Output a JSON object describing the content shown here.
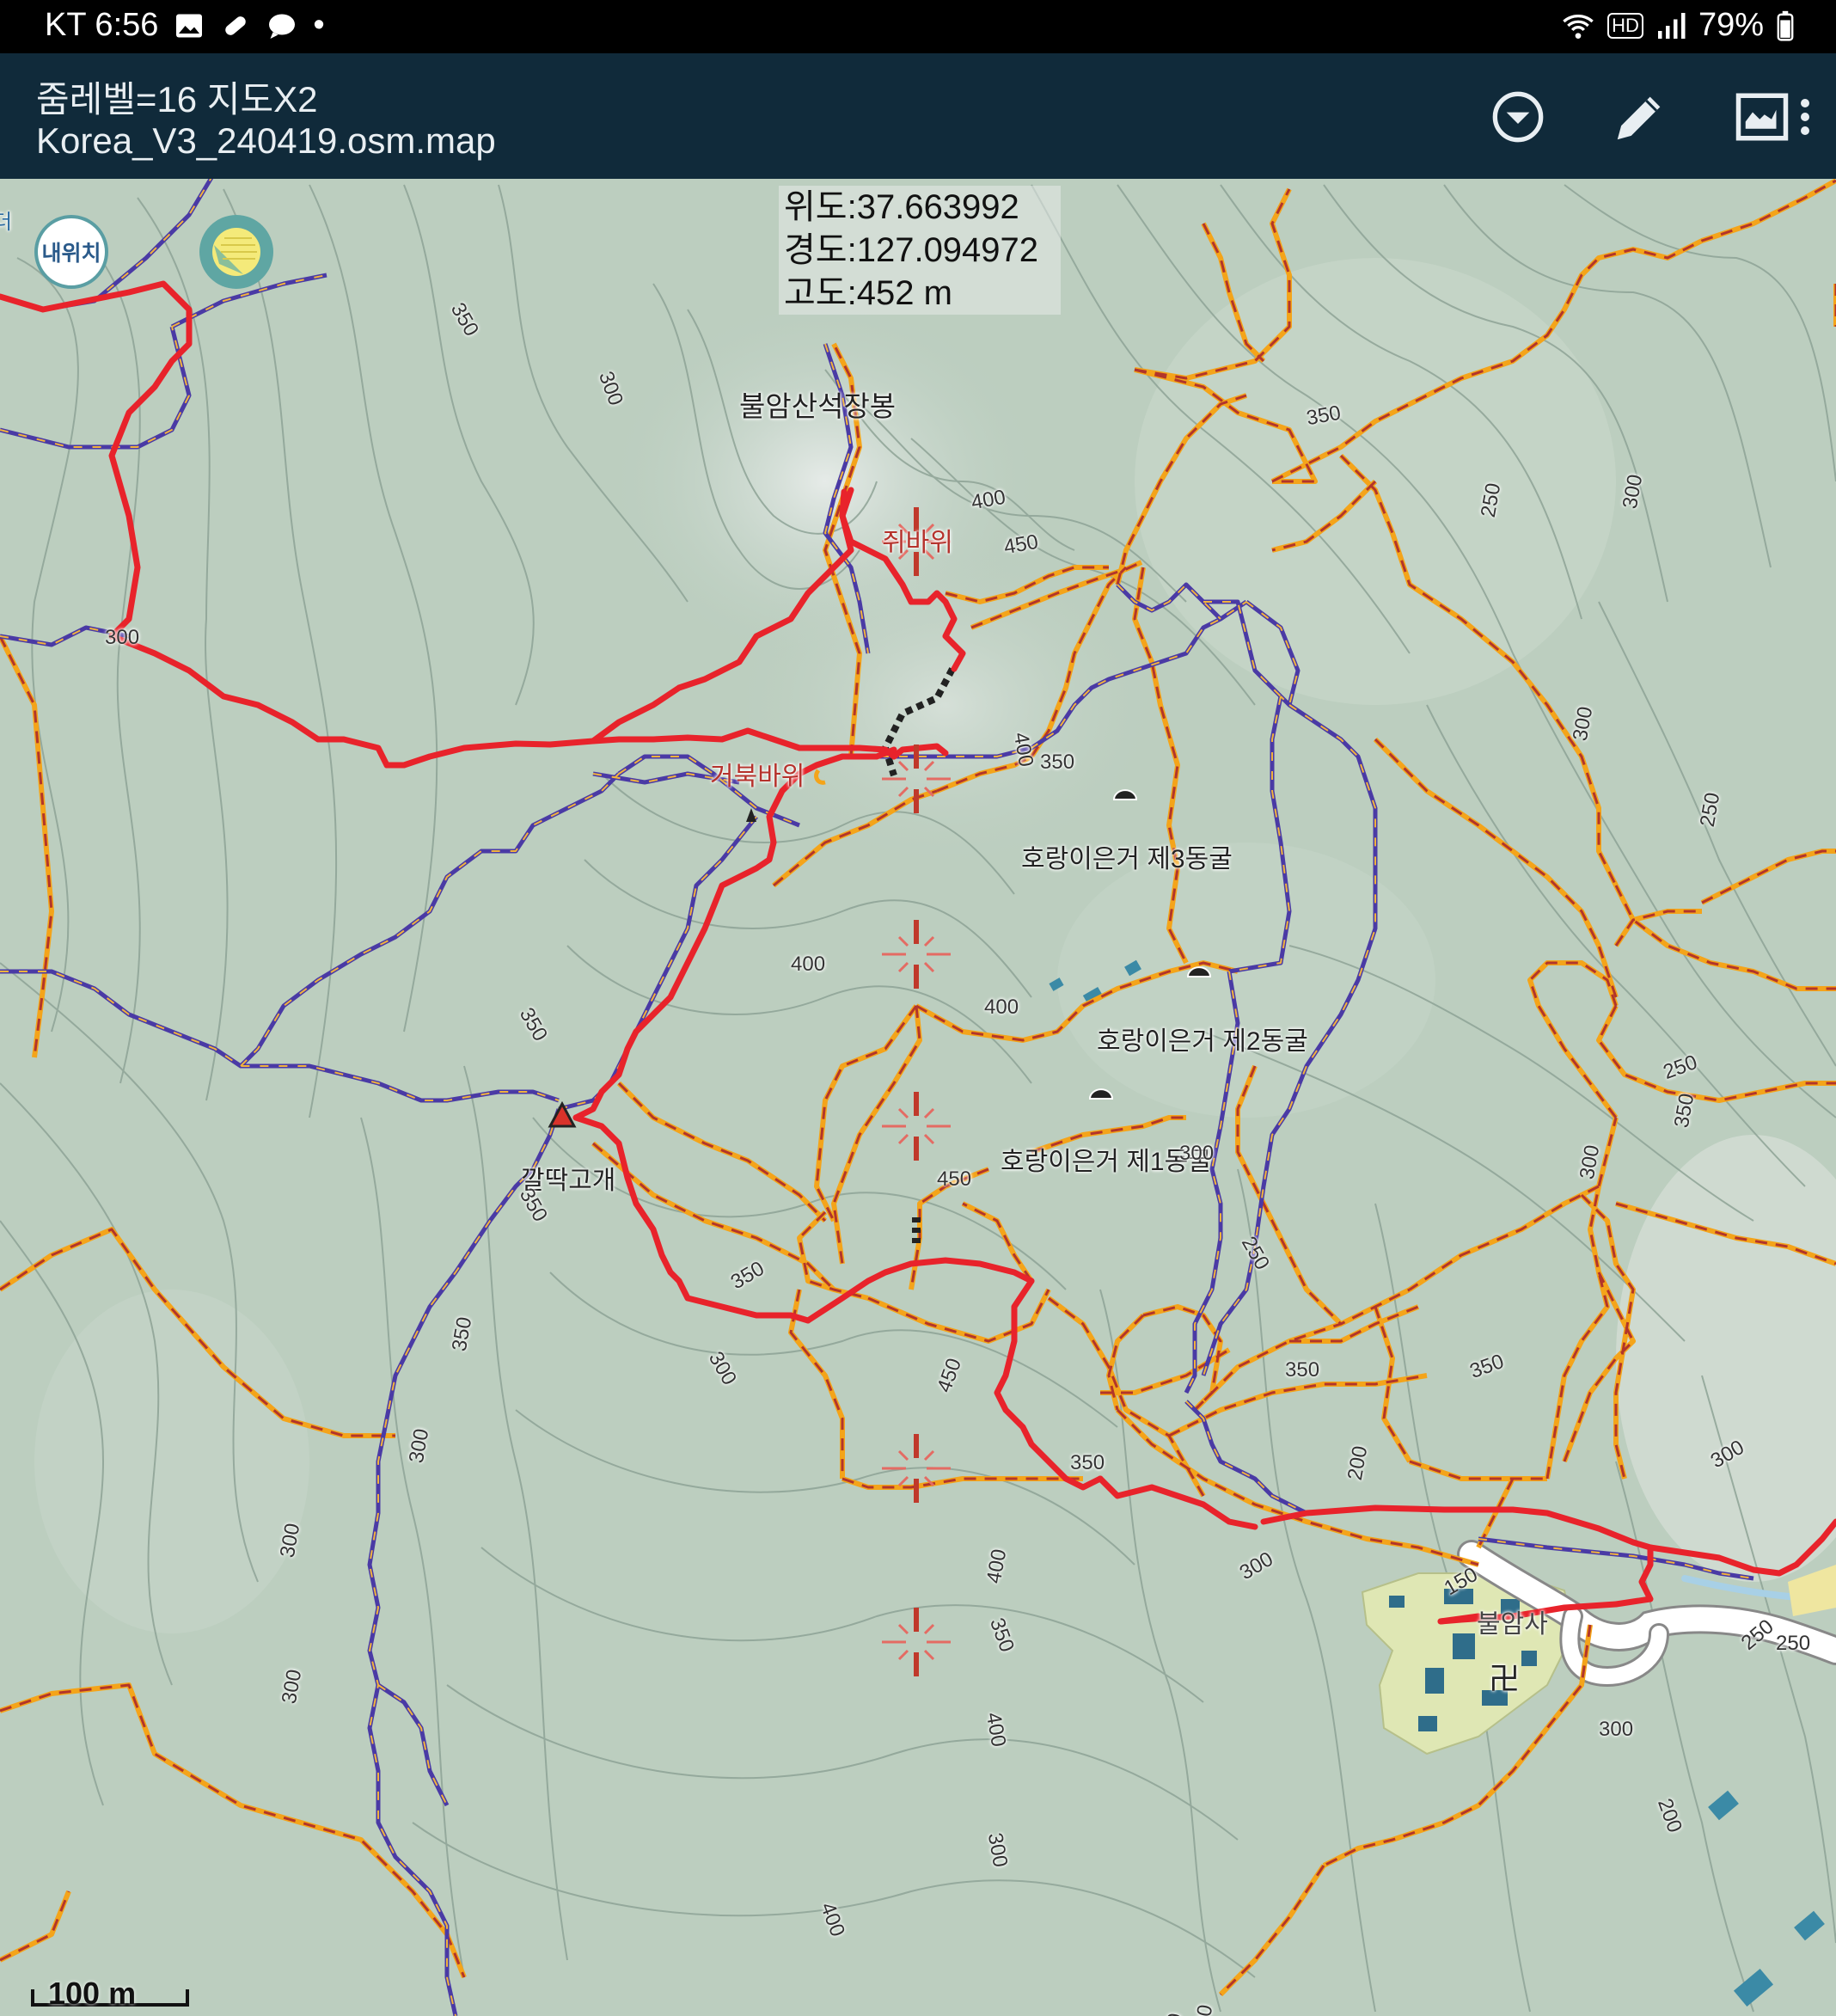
{
  "status_bar": {
    "carrier_time": "KT 6:56",
    "battery": "79%",
    "hd": "HD",
    "icons": [
      "gallery-icon",
      "pill-icon",
      "chat-icon",
      "dot-icon",
      "wifi-icon",
      "signal-icon",
      "battery-icon"
    ]
  },
  "app_bar": {
    "title": "줌레벨=16 지도X2",
    "subtitle": "Korea_V3_240419.osm.map",
    "actions": [
      "dropdown-icon",
      "pencil-icon",
      "map-layer-icon",
      "more-vert-icon"
    ]
  },
  "coords": {
    "lat": "위도:37.663992",
    "lon": "경도:127.094972",
    "alt": "고도:452 m"
  },
  "buttons": {
    "my_location": "내위치"
  },
  "labels": {
    "peak": "불암산석장봉",
    "rock1": "쥐바위",
    "rock2": "거북바위",
    "cave3": "호랑이은거 제3동굴",
    "cave2": "호랑이은거 제2동굴",
    "cave1": "호랑이은거 제1동굴",
    "pass": "깔딱고개",
    "temple": "불암사",
    "temple_symbol": "卍",
    "edge_char": "더"
  },
  "contours": [
    "350",
    "400",
    "450",
    "450",
    "450",
    "350",
    "400",
    "300",
    "300",
    "300",
    "250",
    "350",
    "400",
    "350",
    "300",
    "250",
    "300",
    "350",
    "250",
    "350",
    "300",
    "250",
    "300",
    "350",
    "300",
    "250",
    "200",
    "150",
    "250",
    "350",
    "350",
    "300",
    "300",
    "300",
    "300",
    "350",
    "400",
    "350",
    "400",
    "400",
    "350",
    "300",
    "250",
    "200",
    "150",
    "200",
    "300",
    "400",
    "300"
  ],
  "colors": {
    "route_red": "#e8232b",
    "trail_orange": "#f4a41a",
    "trail_dash": "#b2352a",
    "trail_purple": "#4a3aa5",
    "app_bar": "#102a3a",
    "background": "#b9ccbf"
  },
  "scale_bar": "100 m"
}
